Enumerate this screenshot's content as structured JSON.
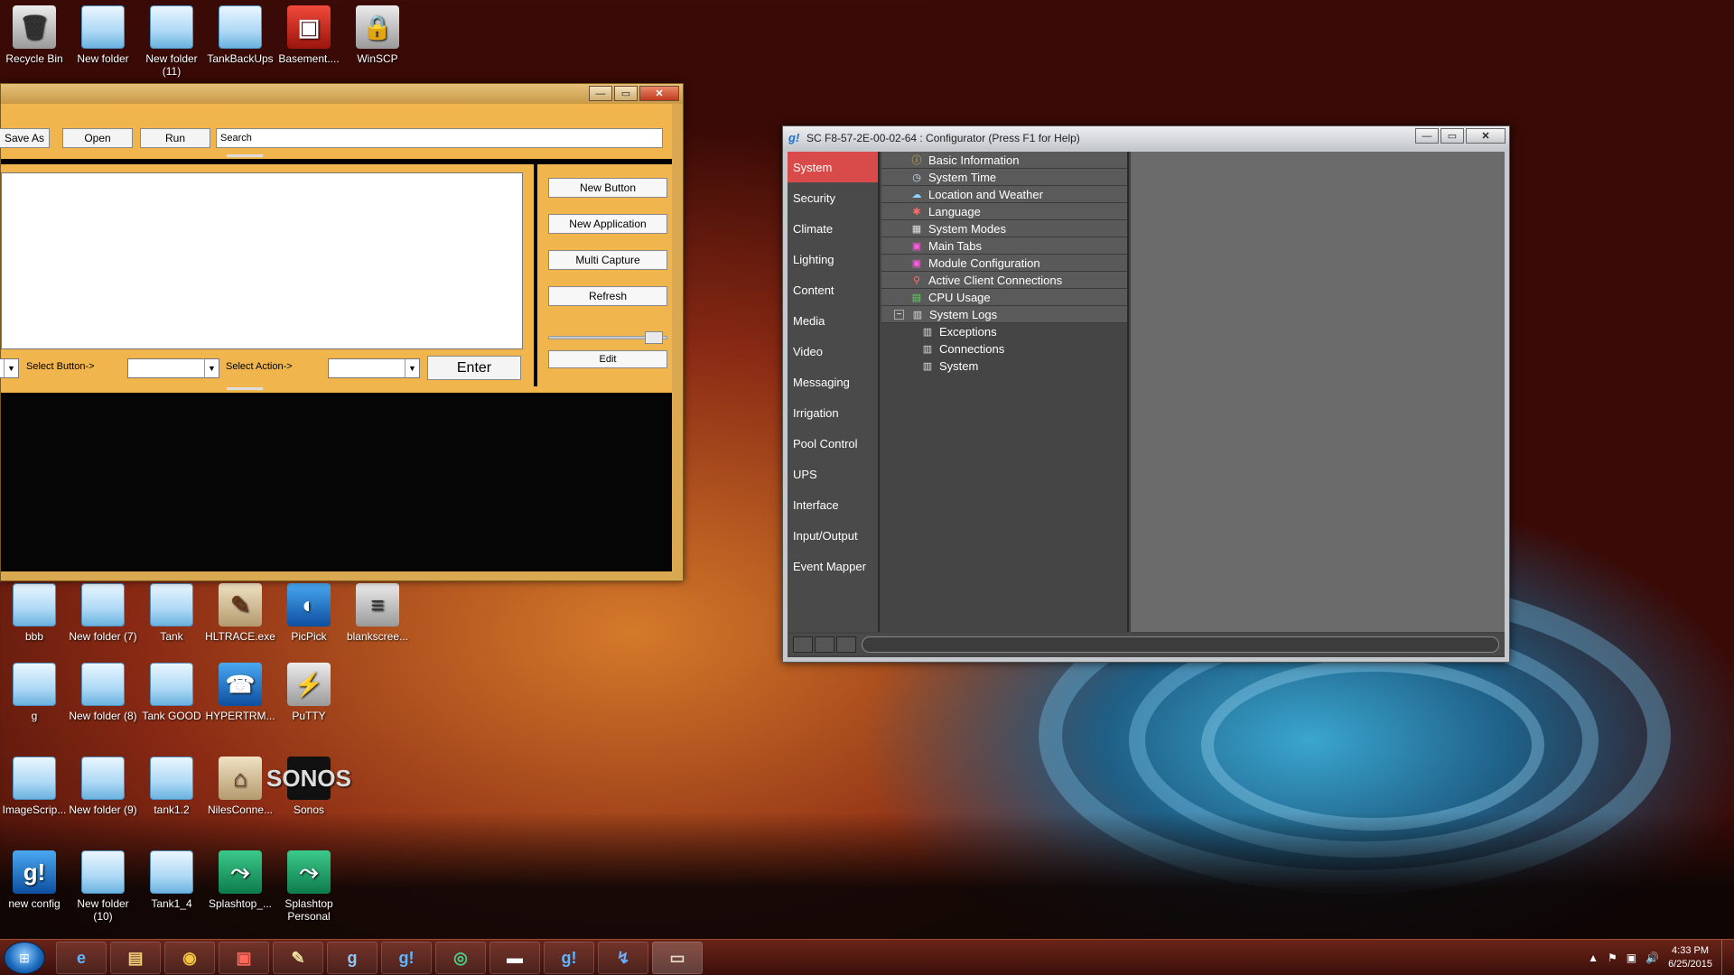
{
  "desktop": {
    "icons_top": [
      {
        "label": "Recycle Bin",
        "icon": "recycle-bin"
      },
      {
        "label": "New folder",
        "icon": "folder"
      },
      {
        "label": "New folder (11)",
        "icon": "folder"
      },
      {
        "label": "TankBackUps",
        "icon": "folder"
      },
      {
        "label": "Basement....",
        "icon": "shortcut-app"
      },
      {
        "label": "WinSCP",
        "icon": "winscp"
      }
    ],
    "icons_row1": [
      {
        "label": "bbb"
      },
      {
        "label": "New folder (7)"
      },
      {
        "label": "Tank"
      },
      {
        "label": "HLTRACE.exe"
      },
      {
        "label": "PicPick"
      },
      {
        "label": "blankscree..."
      }
    ],
    "icons_row2": [
      {
        "label": "g"
      },
      {
        "label": "New folder (8)"
      },
      {
        "label": "Tank GOOD"
      },
      {
        "label": "HYPERTRM..."
      },
      {
        "label": "PuTTY"
      }
    ],
    "icons_row3": [
      {
        "label": "ImageScrip..."
      },
      {
        "label": "New folder (9)"
      },
      {
        "label": "tank1.2"
      },
      {
        "label": "NilesConne..."
      },
      {
        "label": "Sonos"
      }
    ],
    "icons_row4": [
      {
        "label": "new config"
      },
      {
        "label": "New folder (10)"
      },
      {
        "label": "Tank1_4"
      },
      {
        "label": "Splashtop_..."
      },
      {
        "label": "Splashtop Personal"
      }
    ]
  },
  "app_window": {
    "toolbar": {
      "save_as": "Save As",
      "open": "Open",
      "run": "Run",
      "search_value": "Search"
    },
    "right_buttons": {
      "new_button": "New Button",
      "new_application": "New Application",
      "multi_capture": "Multi Capture",
      "refresh": "Refresh",
      "edit": "Edit"
    },
    "controls": {
      "select_button_label": "Select Button->",
      "select_action_label": "Select Action->",
      "enter": "Enter"
    }
  },
  "configurator": {
    "title": "SC F8-57-2E-00-02-64 : Configurator  (Press F1 for Help)",
    "nav": [
      "System",
      "Security",
      "Climate",
      "Lighting",
      "Content",
      "Media",
      "Video",
      "Messaging",
      "Irrigation",
      "Pool Control",
      "UPS",
      "Interface",
      "Input/Output",
      "Event Mapper"
    ],
    "active_nav": "System",
    "tree": [
      {
        "label": "Basic Information",
        "level": 0,
        "icon": "info-icon"
      },
      {
        "label": "System Time",
        "level": 0,
        "icon": "clock-icon"
      },
      {
        "label": "Location and Weather",
        "level": 0,
        "icon": "weather-icon"
      },
      {
        "label": "Language",
        "level": 0,
        "icon": "language-icon"
      },
      {
        "label": "System Modes",
        "level": 0,
        "icon": "modes-icon"
      },
      {
        "label": "Main Tabs",
        "level": 0,
        "icon": "tabs-icon"
      },
      {
        "label": "Module Configuration",
        "level": 0,
        "icon": "module-icon"
      },
      {
        "label": "Active Client Connections",
        "level": 0,
        "icon": "connections-icon"
      },
      {
        "label": "CPU Usage",
        "level": 0,
        "icon": "cpu-icon"
      },
      {
        "label": "System Logs",
        "level": 0,
        "icon": "log-icon",
        "expanded": true
      },
      {
        "label": "Exceptions",
        "level": 1,
        "icon": "log-icon"
      },
      {
        "label": "Connections",
        "level": 1,
        "icon": "log-icon"
      },
      {
        "label": "System",
        "level": 1,
        "icon": "log-icon"
      }
    ]
  },
  "taskbar": {
    "clock_time": "4:33 PM",
    "clock_date": "6/25/2015"
  }
}
